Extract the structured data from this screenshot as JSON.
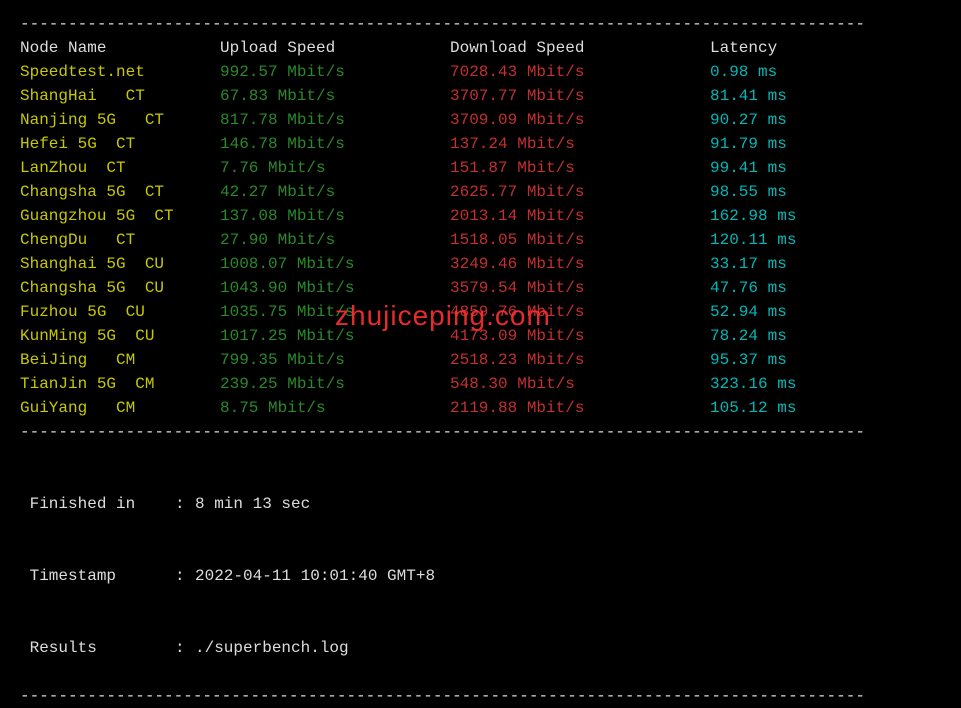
{
  "divider": "----------------------------------------------------------------------------------------",
  "header": {
    "node": "Node Name",
    "upload": "Upload Speed",
    "download": "Download Speed",
    "latency": "Latency"
  },
  "rows": [
    {
      "node": "Speedtest.net",
      "upload": "992.57 Mbit/s",
      "download": "7028.43 Mbit/s",
      "latency": "0.98 ms"
    },
    {
      "node": "ShangHai   CT",
      "upload": "67.83 Mbit/s",
      "download": "3707.77 Mbit/s",
      "latency": "81.41 ms"
    },
    {
      "node": "Nanjing 5G   CT",
      "upload": "817.78 Mbit/s",
      "download": "3709.09 Mbit/s",
      "latency": "90.27 ms"
    },
    {
      "node": "Hefei 5G  CT",
      "upload": "146.78 Mbit/s",
      "download": "137.24 Mbit/s",
      "latency": "91.79 ms"
    },
    {
      "node": "LanZhou  CT",
      "upload": "7.76 Mbit/s",
      "download": "151.87 Mbit/s",
      "latency": "99.41 ms"
    },
    {
      "node": "Changsha 5G  CT",
      "upload": "42.27 Mbit/s",
      "download": "2625.77 Mbit/s",
      "latency": "98.55 ms"
    },
    {
      "node": "Guangzhou 5G  CT",
      "upload": "137.08 Mbit/s",
      "download": "2013.14 Mbit/s",
      "latency": "162.98 ms"
    },
    {
      "node": "ChengDu   CT",
      "upload": "27.90 Mbit/s",
      "download": "1518.05 Mbit/s",
      "latency": "120.11 ms"
    },
    {
      "node": "Shanghai 5G  CU",
      "upload": "1008.07 Mbit/s",
      "download": "3249.46 Mbit/s",
      "latency": "33.17 ms"
    },
    {
      "node": "Changsha 5G  CU",
      "upload": "1043.90 Mbit/s",
      "download": "3579.54 Mbit/s",
      "latency": "47.76 ms"
    },
    {
      "node": "Fuzhou 5G  CU",
      "upload": "1035.75 Mbit/s",
      "download": "4859.76 Mbit/s",
      "latency": "52.94 ms"
    },
    {
      "node": "KunMing 5G  CU",
      "upload": "1017.25 Mbit/s",
      "download": "4173.09 Mbit/s",
      "latency": "78.24 ms"
    },
    {
      "node": "BeiJing   CM",
      "upload": "799.35 Mbit/s",
      "download": "2518.23 Mbit/s",
      "latency": "95.37 ms"
    },
    {
      "node": "TianJin 5G  CM",
      "upload": "239.25 Mbit/s",
      "download": "548.30 Mbit/s",
      "latency": "323.16 ms"
    },
    {
      "node": "GuiYang   CM",
      "upload": "8.75 Mbit/s",
      "download": "2119.88 Mbit/s",
      "latency": "105.12 ms"
    }
  ],
  "footer": {
    "finished_label": " Finished in",
    "finished_value": "8 min 13 sec",
    "timestamp_label": " Timestamp",
    "timestamp_value": "2022-04-11 10:01:40 GMT+8",
    "results_label": " Results",
    "results_value": "./superbench.log",
    "sep": ": "
  },
  "watermark": "zhujiceping.com"
}
